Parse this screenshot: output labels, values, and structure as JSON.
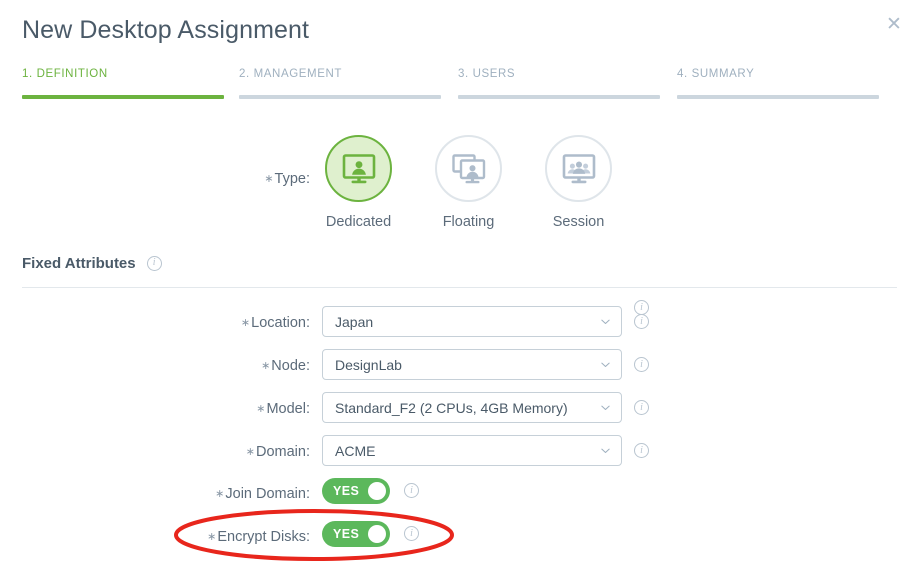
{
  "dialog": {
    "title": "New Desktop Assignment",
    "close_label": "✕",
    "close_icon": "close-icon"
  },
  "wizard": {
    "tabs": [
      {
        "label": "1. DEFINITION",
        "active": true
      },
      {
        "label": "2. MANAGEMENT",
        "active": false
      },
      {
        "label": "3. USERS",
        "active": false
      },
      {
        "label": "4. SUMMARY",
        "active": false
      }
    ],
    "active_color": "#6cb33f",
    "inactive_color": "#ccd6de"
  },
  "type_field": {
    "label": "Type:",
    "required_marker": "∗",
    "info_icon": "info-icon",
    "options": [
      {
        "name": "Dedicated",
        "icon": "monitor-single-user-icon",
        "selected": true
      },
      {
        "name": "Floating",
        "icon": "monitor-stacked-icon",
        "selected": false
      },
      {
        "name": "Session",
        "icon": "monitor-multi-user-icon",
        "selected": false
      }
    ],
    "selected_value": "Dedicated",
    "selected_color": "#6cb33f",
    "selected_fill": "#dff0ce"
  },
  "fixed_attributes": {
    "title": "Fixed Attributes",
    "info_icon": "info-icon",
    "fields": [
      {
        "label": "Location:",
        "value": "Japan",
        "type": "select",
        "required": true
      },
      {
        "label": "Node:",
        "value": "DesignLab",
        "type": "select",
        "required": true
      },
      {
        "label": "Model:",
        "value": "Standard_F2 (2 CPUs, 4GB Memory)",
        "type": "select",
        "required": true
      },
      {
        "label": "Domain:",
        "value": "ACME",
        "type": "select",
        "required": true
      }
    ],
    "toggles": [
      {
        "label": "Join Domain:",
        "value": "YES",
        "required": true,
        "on": true
      },
      {
        "label": "Encrypt Disks:",
        "value": "YES",
        "required": true,
        "on": true
      }
    ],
    "required_marker": "∗",
    "toggle_on_color": "#5cb85c",
    "chevron_icon": "chevron-down-icon"
  },
  "annotation": {
    "shape": "ellipse",
    "color": "#e8261c",
    "target": "Encrypt Disks"
  }
}
